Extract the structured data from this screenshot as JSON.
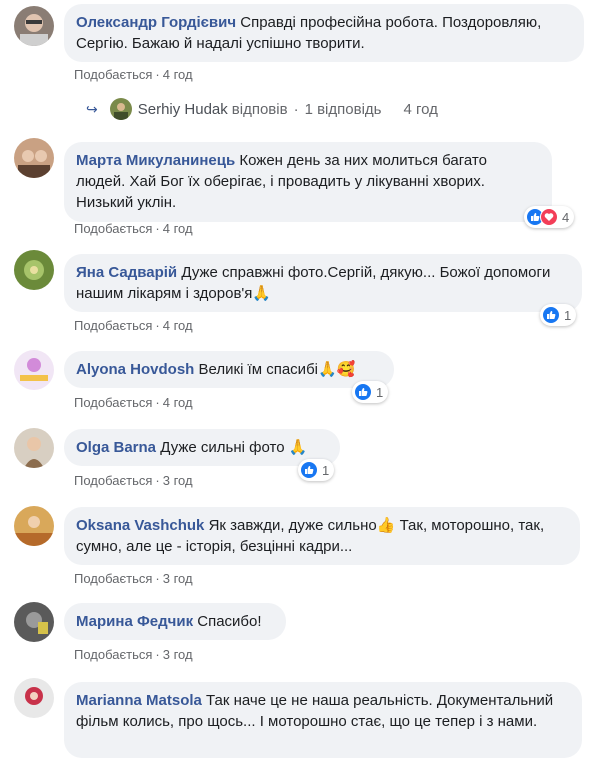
{
  "comments": [
    {
      "author": "Олександр Гордієвич",
      "text": "Справді професійна робота. Поздоровляю, Сергію. Бажаю й надалі успішно творити.",
      "like_label": "Подобається",
      "time": "4 год"
    },
    {
      "author": "Марта Микуланинець",
      "text": "Кожен день за них молиться багато людей. Хай Бог їх оберігає, і провадить у лікуванні хворих. Низький уклін.",
      "like_label": "Подобається",
      "time": "4 год",
      "reaction_count": "4"
    },
    {
      "author": "Яна Садварій",
      "text": "Дуже справжні фото.Сергій, дякую... Божої допомоги нашим лікарям і здоров'я",
      "like_label": "Подобається",
      "time": "4 год",
      "reaction_count": "1"
    },
    {
      "author": "Alyona Hovdosh",
      "text": "Великі їм спасибі",
      "like_label": "Подобається",
      "time": "4 год",
      "reaction_count": "1"
    },
    {
      "author": "Olga Barna",
      "text": "Дуже сильні фото",
      "like_label": "Подобається",
      "time": "3 год",
      "reaction_count": "1"
    },
    {
      "author": "Oksana Vashchuk",
      "text": "Як завжди, дуже сильно",
      "text2": "Так, моторошно, так, сумно, але це - історія, безцінні кадри...",
      "like_label": "Подобається",
      "time": "3 год"
    },
    {
      "author": "Марина Федчик",
      "text": "Спасибо!",
      "like_label": "Подобається",
      "time": "3 год"
    },
    {
      "author": "Marianna Matsola",
      "text": "Так наче це не наша реальність. Документальний фільм колись, про щось... І моторошно стає, що це тепер і з нами.",
      "like_label": "",
      "time": ""
    }
  ],
  "reply": {
    "author": "Serhiy Hudak",
    "action": "відповів",
    "count": "1 відповідь",
    "time": "4 год"
  },
  "colors": {
    "author_link": "#385898",
    "bubble_bg": "#f0f2f5",
    "like_blue": "#1877f2",
    "love_red": "#f33e58",
    "meta_gray": "#65676b"
  }
}
